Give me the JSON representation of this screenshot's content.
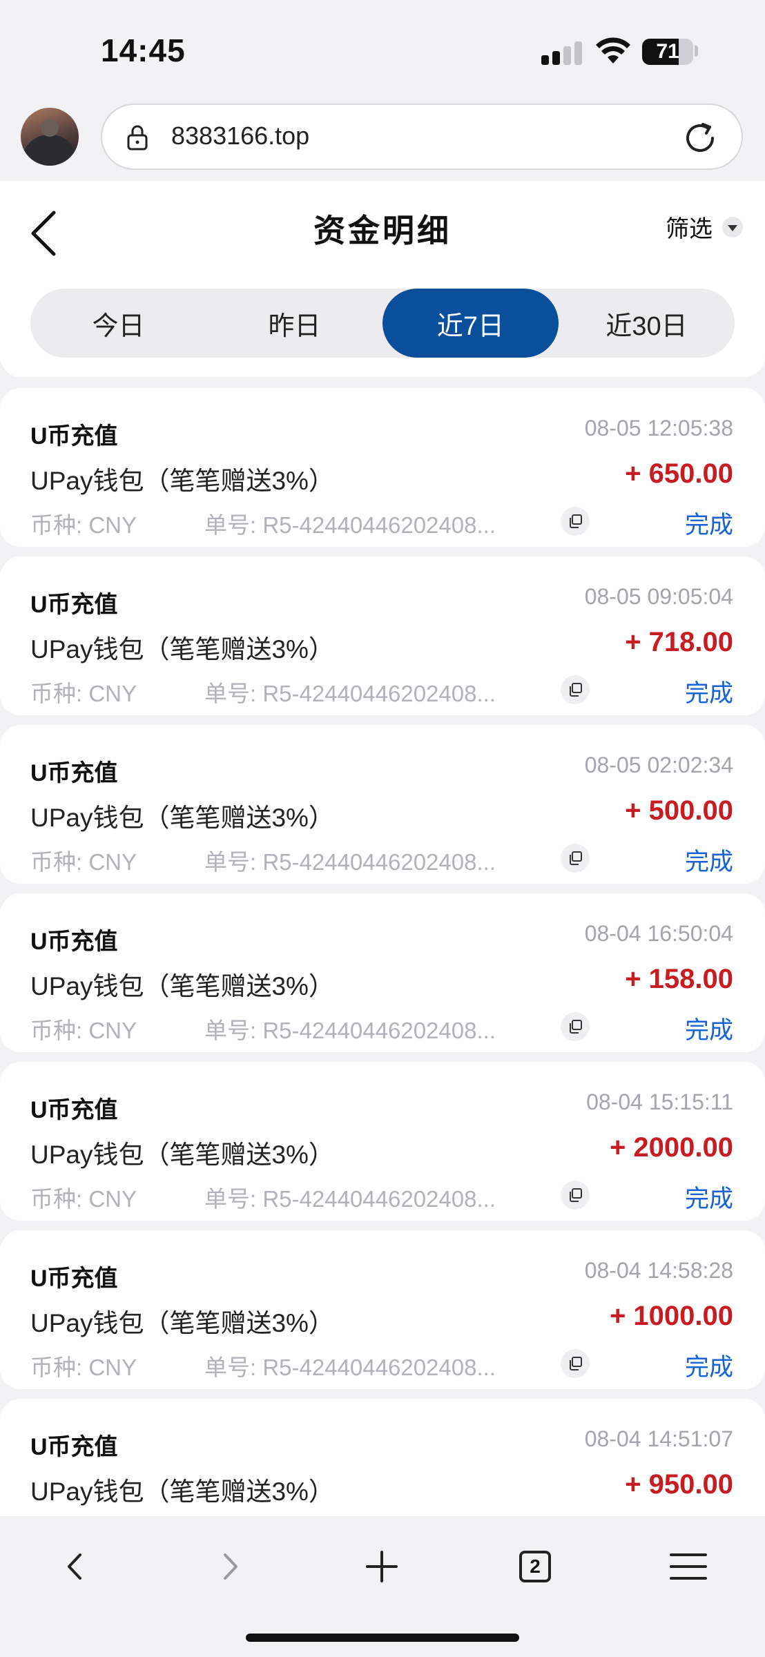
{
  "status_bar": {
    "time": "14:45",
    "battery": "71",
    "battery_level": 0.71
  },
  "browser": {
    "url": "8383166.top",
    "tab_count": "2"
  },
  "page": {
    "title": "资金明细",
    "filter_label": "筛选"
  },
  "tabs": [
    {
      "label": "今日",
      "active": false
    },
    {
      "label": "昨日",
      "active": false
    },
    {
      "label": "近7日",
      "active": true
    },
    {
      "label": "近30日",
      "active": false
    }
  ],
  "records": [
    {
      "title": "U币充值",
      "time": "08-05 12:05:38",
      "method": "UPay钱包（笔笔赠送3%）",
      "amount": "+ 650.00",
      "currency": "币种: CNY",
      "order": "单号: R5-42440446202408...",
      "status": "完成"
    },
    {
      "title": "U币充值",
      "time": "08-05 09:05:04",
      "method": "UPay钱包（笔笔赠送3%）",
      "amount": "+ 718.00",
      "currency": "币种: CNY",
      "order": "单号: R5-42440446202408...",
      "status": "完成"
    },
    {
      "title": "U币充值",
      "time": "08-05 02:02:34",
      "method": "UPay钱包（笔笔赠送3%）",
      "amount": "+ 500.00",
      "currency": "币种: CNY",
      "order": "单号: R5-42440446202408...",
      "status": "完成"
    },
    {
      "title": "U币充值",
      "time": "08-04 16:50:04",
      "method": "UPay钱包（笔笔赠送3%）",
      "amount": "+ 158.00",
      "currency": "币种: CNY",
      "order": "单号: R5-42440446202408...",
      "status": "完成"
    },
    {
      "title": "U币充值",
      "time": "08-04 15:15:11",
      "method": "UPay钱包（笔笔赠送3%）",
      "amount": "+ 2000.00",
      "currency": "币种: CNY",
      "order": "单号: R5-42440446202408...",
      "status": "完成"
    },
    {
      "title": "U币充值",
      "time": "08-04 14:58:28",
      "method": "UPay钱包（笔笔赠送3%）",
      "amount": "+ 1000.00",
      "currency": "币种: CNY",
      "order": "单号: R5-42440446202408...",
      "status": "完成"
    },
    {
      "title": "U币充值",
      "time": "08-04 14:51:07",
      "method": "UPay钱包（笔笔赠送3%）",
      "amount": "+ 950.00"
    }
  ],
  "colors": {
    "accent": "#0b4f9c",
    "amount": "#c81c22",
    "status": "#1862d6"
  }
}
